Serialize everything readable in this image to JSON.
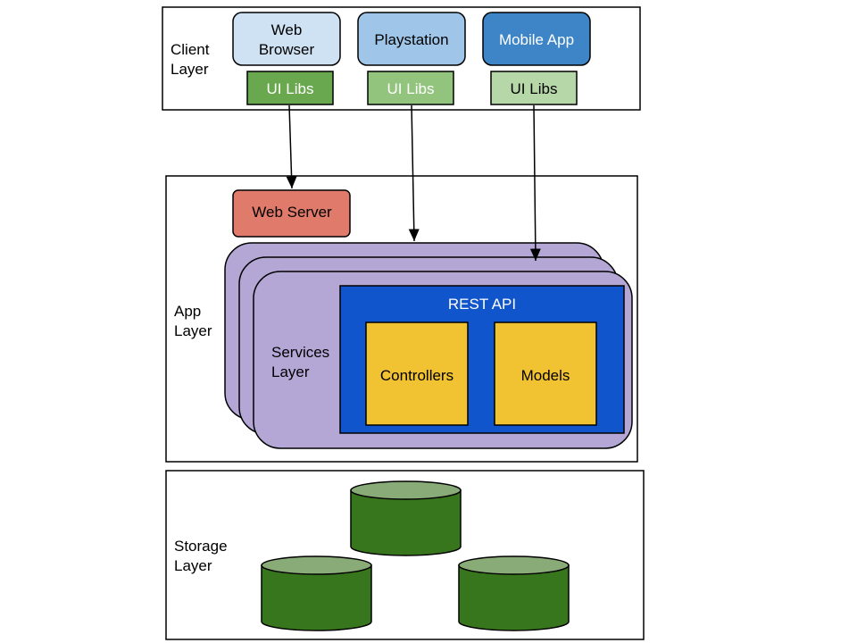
{
  "client_layer": {
    "label_lines": [
      "Client",
      "Layer"
    ],
    "clients": [
      {
        "label_lines": [
          "Web",
          "Browser"
        ],
        "fill": "#cfe2f3",
        "text_color": "#000000"
      },
      {
        "label_lines": [
          "Playstation"
        ],
        "fill": "#9fc5e8",
        "text_color": "#000000"
      },
      {
        "label_lines": [
          "Mobile App"
        ],
        "fill": "#3d85c6",
        "text_color": "#ffffff"
      }
    ],
    "libs": [
      {
        "label": "UI Libs",
        "fill": "#6aa84f",
        "text_color": "#ffffff"
      },
      {
        "label": "UI Libs",
        "fill": "#93c47d",
        "text_color": "#ffffff"
      },
      {
        "label": "UI Libs",
        "fill": "#b6d7a8",
        "text_color": "#000000"
      }
    ]
  },
  "app_layer": {
    "label_lines": [
      "App",
      "Layer"
    ],
    "web_server": {
      "label": "Web Server",
      "fill": "#e06666"
    },
    "services": {
      "label_lines": [
        "Services",
        "Layer"
      ],
      "fill": "#b4a7d6"
    },
    "rest_api": {
      "label": "REST API",
      "fill": "#1155cc"
    },
    "controllers": {
      "label": "Controllers",
      "fill": "#f1c232"
    },
    "models": {
      "label": "Models",
      "fill": "#f1c232"
    }
  },
  "storage_layer": {
    "label_lines": [
      "Storage",
      "Layer"
    ],
    "db_fill": "#38761d",
    "db_top_fill": "#89ab78"
  }
}
